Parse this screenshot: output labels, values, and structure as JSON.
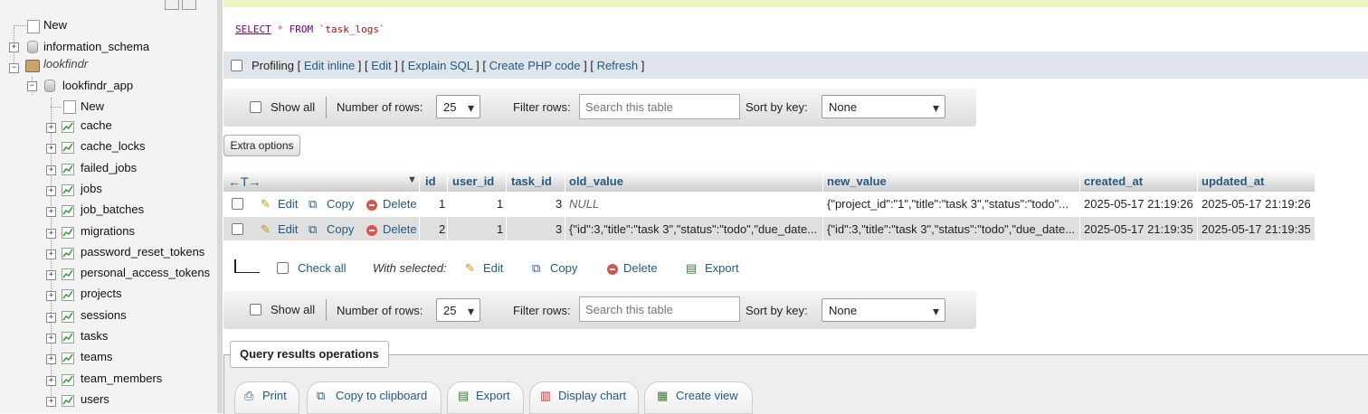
{
  "sidebar": {
    "new_top": "New",
    "dbs": [
      {
        "label": "information_schema"
      },
      {
        "label": "lookfindr"
      }
    ],
    "db_child": "lookfindr_app",
    "new_table": "New",
    "tables": [
      "cache",
      "cache_locks",
      "failed_jobs",
      "jobs",
      "job_batches",
      "migrations",
      "password_reset_tokens",
      "personal_access_tokens",
      "projects",
      "sessions",
      "tasks",
      "teams",
      "team_members",
      "users"
    ]
  },
  "sql": {
    "keyword": "SELECT",
    "star": "*",
    "from": "FROM",
    "table": "`task_logs`"
  },
  "profiling": {
    "label": "Profiling",
    "links": [
      "Edit inline",
      "Edit",
      "Explain SQL",
      "Create PHP code",
      "Refresh"
    ]
  },
  "nav": {
    "show_all": "Show all",
    "rows_label": "Number of rows:",
    "rows_value": "25",
    "filter_label": "Filter rows:",
    "filter_placeholder": "Search this table",
    "sort_label": "Sort by key:",
    "sort_value": "None"
  },
  "extra_options": "Extra options",
  "table": {
    "columns": [
      "id",
      "user_id",
      "task_id",
      "old_value",
      "new_value",
      "created_at",
      "updated_at"
    ],
    "row_actions": {
      "edit": "Edit",
      "copy": "Copy",
      "delete": "Delete"
    },
    "rows": [
      {
        "id": "1",
        "user_id": "1",
        "task_id": "3",
        "old_value": "NULL",
        "new_value": "{\"project_id\":\"1\",\"title\":\"task 3\",\"status\":\"todo\"...",
        "created_at": "2025-05-17 21:19:26",
        "updated_at": "2025-05-17 21:19:26"
      },
      {
        "id": "2",
        "user_id": "1",
        "task_id": "3",
        "old_value": "{\"id\":3,\"title\":\"task 3\",\"status\":\"todo\",\"due_date...",
        "new_value": "{\"id\":3,\"title\":\"task 3\",\"status\":\"todo\",\"due_date...",
        "created_at": "2025-05-17 21:19:35",
        "updated_at": "2025-05-17 21:19:35"
      }
    ]
  },
  "bulk": {
    "check_all": "Check all",
    "with_selected": "With selected:",
    "edit": "Edit",
    "copy": "Copy",
    "delete": "Delete",
    "export": "Export"
  },
  "ops": {
    "title": "Query results operations",
    "print": "Print",
    "copy_clipboard": "Copy to clipboard",
    "export": "Export",
    "display_chart": "Display chart",
    "create_view": "Create view"
  },
  "colors": {
    "link": "#235a81",
    "delete": "#d9534f",
    "banner": "#ebf7c0"
  }
}
